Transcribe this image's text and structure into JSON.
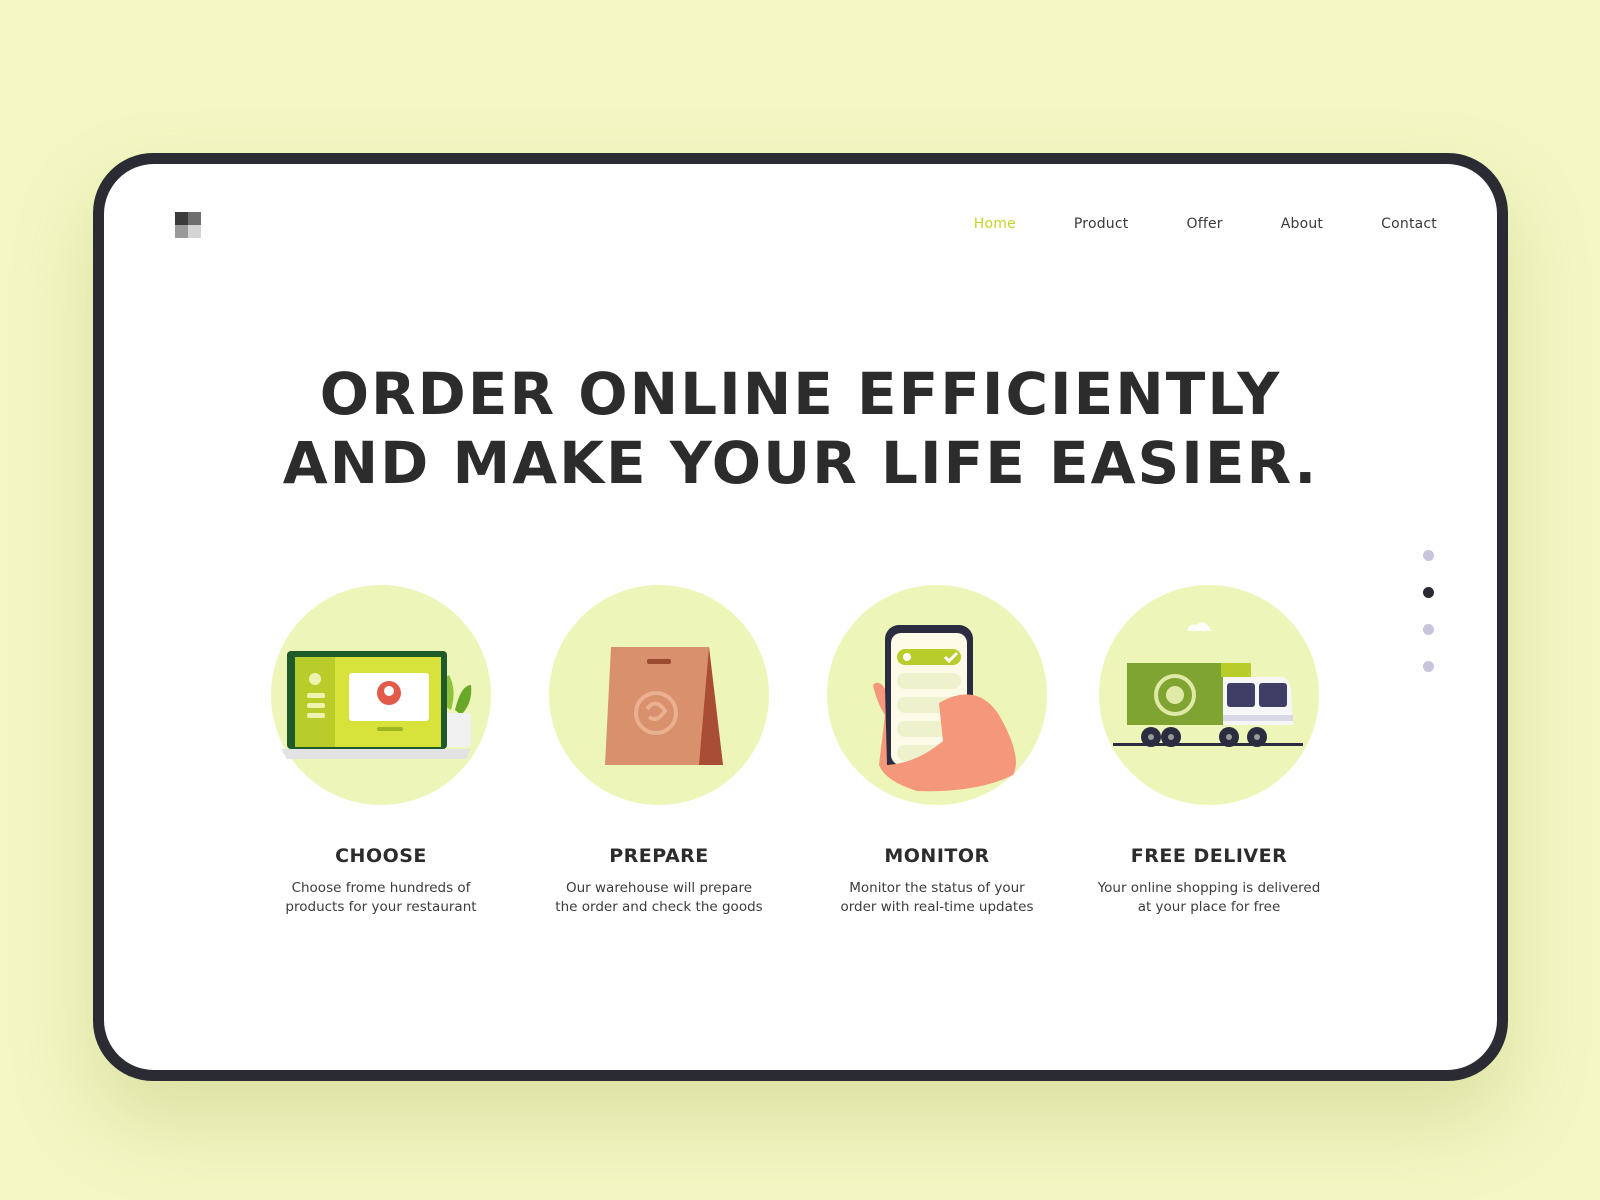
{
  "nav": {
    "items": [
      {
        "label": "Home",
        "active": true
      },
      {
        "label": "Product",
        "active": false
      },
      {
        "label": "Offer",
        "active": false
      },
      {
        "label": "About",
        "active": false
      },
      {
        "label": "Contact",
        "active": false
      }
    ]
  },
  "hero": {
    "line1": "ORDER ONLINE EFFICIENTLY",
    "line2": "AND MAKE YOUR LIFE EASIER."
  },
  "features": [
    {
      "icon": "laptop-icon",
      "title": "CHOOSE",
      "text": "Choose frome hundreds of\nproducts for your restaurant"
    },
    {
      "icon": "shopping-bag-icon",
      "title": "PREPARE",
      "text": "Our warehouse will prepare\nthe order and check the goods"
    },
    {
      "icon": "phone-in-hand-icon",
      "title": "MONITOR",
      "text": "Monitor the status of your\norder with real-time updates"
    },
    {
      "icon": "delivery-truck-icon",
      "title": "FREE DELIVER",
      "text": "Your online shopping is delivered\nat your place for free"
    }
  ],
  "pagination": {
    "count": 4,
    "active_index": 1
  },
  "colors": {
    "background": "#f3f7c4",
    "accent": "#c6d52a",
    "circle": "#edf6b8",
    "frame": "#2b2c33",
    "text": "#2c2c2c"
  }
}
